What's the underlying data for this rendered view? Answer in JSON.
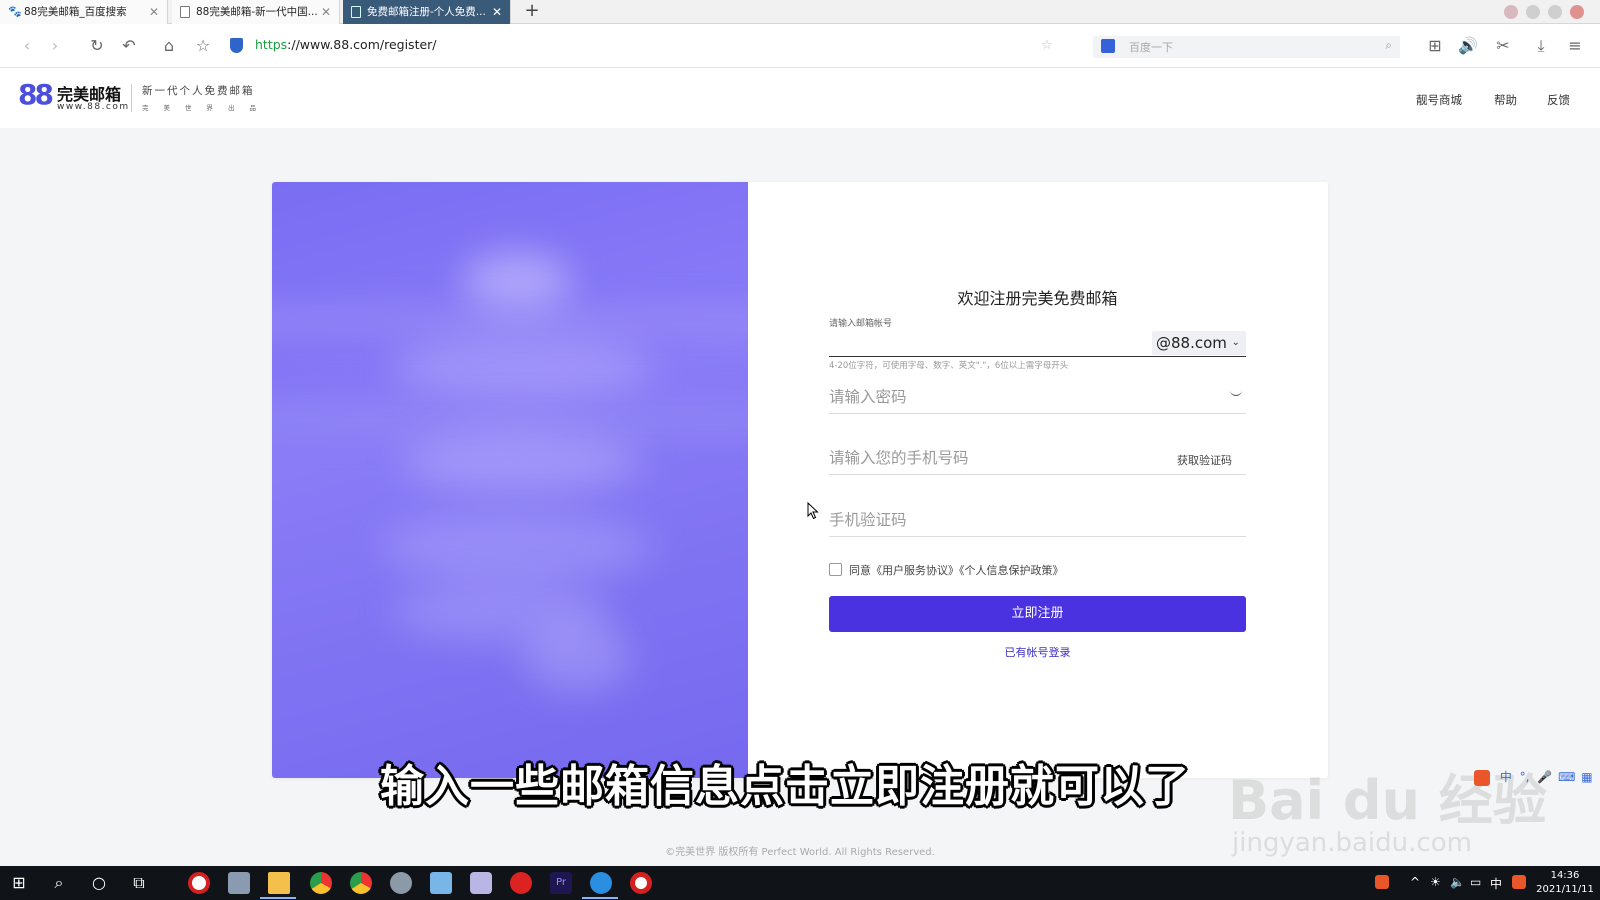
{
  "browser": {
    "tabs": [
      {
        "label": "88完美邮箱_百度搜索",
        "active": false,
        "icon": "paw-icon"
      },
      {
        "label": "88完美邮箱-新一代中国...",
        "active": false,
        "icon": "page-icon"
      },
      {
        "label": "免费邮箱注册-个人免费...",
        "active": true,
        "icon": "page-icon"
      }
    ],
    "new_tab": "+",
    "url_scheme": "https",
    "url_rest": "://www.88.com/register/",
    "search_placeholder": "百度一下"
  },
  "site": {
    "logo_mark": "88",
    "logo_name": "完美邮箱",
    "logo_url": "www.88.com",
    "tagline": "新一代个人免费邮箱",
    "tagline_small": "完美世界出品",
    "nav": [
      "靓号商城",
      "帮助",
      "反馈"
    ]
  },
  "register_form": {
    "title": "欢迎注册完美免费邮箱",
    "email_label": "请输入邮箱帐号",
    "email_value": "",
    "domain": "@88.com",
    "email_hint": "4-20位字符，可使用字母、数字、英文\".\"，6位以上需字母开头",
    "password_placeholder": "请输入密码",
    "phone_placeholder": "请输入您的手机号码",
    "get_code": "获取验证码",
    "sms_code_placeholder": "手机验证码",
    "agree_text": "同意《用户服务协议》《个人信息保护政策》",
    "agree_checked": false,
    "submit_label": "立即注册",
    "login_link": "已有帐号登录"
  },
  "footer": "©完美世界 版权所有 Perfect World. All Rights Reserved.",
  "overlay": {
    "subtitle": "输入一些邮箱信息点击立即注册就可以了",
    "watermark_main": "Bai du 经验",
    "watermark_url": "jingyan.baidu.com"
  },
  "taskbar": {
    "time": "14:36",
    "date": "2021/11/11",
    "ime": "中"
  },
  "colors": {
    "accent": "#4a32e0",
    "hero": "#7f72f2",
    "active_tab": "#3a5a7a"
  }
}
